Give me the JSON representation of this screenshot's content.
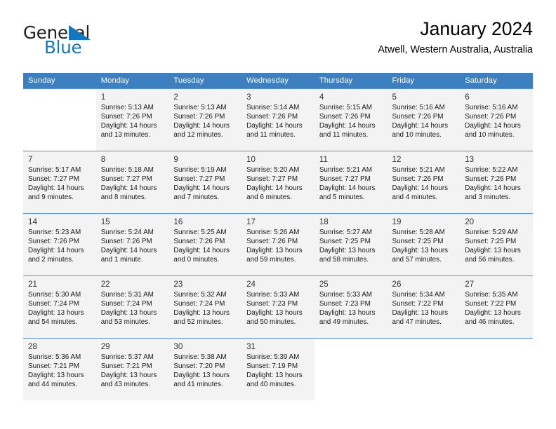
{
  "brand": {
    "name_part1": "General",
    "name_part2": "Blue",
    "triangle_color": "#1278be"
  },
  "header": {
    "title": "January 2024",
    "subtitle": "Atwell, Western Australia, Australia"
  },
  "theme": {
    "header_row_bg": "#3d7fbf",
    "header_row_text": "#ffffff",
    "row_shaded_bg": "#f3f3f3",
    "row_plain_bg": "#ffffff",
    "cell_border": "#5b92cd"
  },
  "calendar": {
    "weekdays": [
      "Sunday",
      "Monday",
      "Tuesday",
      "Wednesday",
      "Thursday",
      "Friday",
      "Saturday"
    ],
    "weeks": [
      [
        {
          "day": "",
          "sunrise": "",
          "sunset": "",
          "daylight1": "",
          "daylight2": ""
        },
        {
          "day": "1",
          "sunrise": "Sunrise: 5:13 AM",
          "sunset": "Sunset: 7:26 PM",
          "daylight1": "Daylight: 14 hours",
          "daylight2": "and 13 minutes."
        },
        {
          "day": "2",
          "sunrise": "Sunrise: 5:13 AM",
          "sunset": "Sunset: 7:26 PM",
          "daylight1": "Daylight: 14 hours",
          "daylight2": "and 12 minutes."
        },
        {
          "day": "3",
          "sunrise": "Sunrise: 5:14 AM",
          "sunset": "Sunset: 7:26 PM",
          "daylight1": "Daylight: 14 hours",
          "daylight2": "and 11 minutes."
        },
        {
          "day": "4",
          "sunrise": "Sunrise: 5:15 AM",
          "sunset": "Sunset: 7:26 PM",
          "daylight1": "Daylight: 14 hours",
          "daylight2": "and 11 minutes."
        },
        {
          "day": "5",
          "sunrise": "Sunrise: 5:16 AM",
          "sunset": "Sunset: 7:26 PM",
          "daylight1": "Daylight: 14 hours",
          "daylight2": "and 10 minutes."
        },
        {
          "day": "6",
          "sunrise": "Sunrise: 5:16 AM",
          "sunset": "Sunset: 7:26 PM",
          "daylight1": "Daylight: 14 hours",
          "daylight2": "and 10 minutes."
        }
      ],
      [
        {
          "day": "7",
          "sunrise": "Sunrise: 5:17 AM",
          "sunset": "Sunset: 7:27 PM",
          "daylight1": "Daylight: 14 hours",
          "daylight2": "and 9 minutes."
        },
        {
          "day": "8",
          "sunrise": "Sunrise: 5:18 AM",
          "sunset": "Sunset: 7:27 PM",
          "daylight1": "Daylight: 14 hours",
          "daylight2": "and 8 minutes."
        },
        {
          "day": "9",
          "sunrise": "Sunrise: 5:19 AM",
          "sunset": "Sunset: 7:27 PM",
          "daylight1": "Daylight: 14 hours",
          "daylight2": "and 7 minutes."
        },
        {
          "day": "10",
          "sunrise": "Sunrise: 5:20 AM",
          "sunset": "Sunset: 7:27 PM",
          "daylight1": "Daylight: 14 hours",
          "daylight2": "and 6 minutes."
        },
        {
          "day": "11",
          "sunrise": "Sunrise: 5:21 AM",
          "sunset": "Sunset: 7:27 PM",
          "daylight1": "Daylight: 14 hours",
          "daylight2": "and 5 minutes."
        },
        {
          "day": "12",
          "sunrise": "Sunrise: 5:21 AM",
          "sunset": "Sunset: 7:26 PM",
          "daylight1": "Daylight: 14 hours",
          "daylight2": "and 4 minutes."
        },
        {
          "day": "13",
          "sunrise": "Sunrise: 5:22 AM",
          "sunset": "Sunset: 7:26 PM",
          "daylight1": "Daylight: 14 hours",
          "daylight2": "and 3 minutes."
        }
      ],
      [
        {
          "day": "14",
          "sunrise": "Sunrise: 5:23 AM",
          "sunset": "Sunset: 7:26 PM",
          "daylight1": "Daylight: 14 hours",
          "daylight2": "and 2 minutes."
        },
        {
          "day": "15",
          "sunrise": "Sunrise: 5:24 AM",
          "sunset": "Sunset: 7:26 PM",
          "daylight1": "Daylight: 14 hours",
          "daylight2": "and 1 minute."
        },
        {
          "day": "16",
          "sunrise": "Sunrise: 5:25 AM",
          "sunset": "Sunset: 7:26 PM",
          "daylight1": "Daylight: 14 hours",
          "daylight2": "and 0 minutes."
        },
        {
          "day": "17",
          "sunrise": "Sunrise: 5:26 AM",
          "sunset": "Sunset: 7:26 PM",
          "daylight1": "Daylight: 13 hours",
          "daylight2": "and 59 minutes."
        },
        {
          "day": "18",
          "sunrise": "Sunrise: 5:27 AM",
          "sunset": "Sunset: 7:25 PM",
          "daylight1": "Daylight: 13 hours",
          "daylight2": "and 58 minutes."
        },
        {
          "day": "19",
          "sunrise": "Sunrise: 5:28 AM",
          "sunset": "Sunset: 7:25 PM",
          "daylight1": "Daylight: 13 hours",
          "daylight2": "and 57 minutes."
        },
        {
          "day": "20",
          "sunrise": "Sunrise: 5:29 AM",
          "sunset": "Sunset: 7:25 PM",
          "daylight1": "Daylight: 13 hours",
          "daylight2": "and 56 minutes."
        }
      ],
      [
        {
          "day": "21",
          "sunrise": "Sunrise: 5:30 AM",
          "sunset": "Sunset: 7:24 PM",
          "daylight1": "Daylight: 13 hours",
          "daylight2": "and 54 minutes."
        },
        {
          "day": "22",
          "sunrise": "Sunrise: 5:31 AM",
          "sunset": "Sunset: 7:24 PM",
          "daylight1": "Daylight: 13 hours",
          "daylight2": "and 53 minutes."
        },
        {
          "day": "23",
          "sunrise": "Sunrise: 5:32 AM",
          "sunset": "Sunset: 7:24 PM",
          "daylight1": "Daylight: 13 hours",
          "daylight2": "and 52 minutes."
        },
        {
          "day": "24",
          "sunrise": "Sunrise: 5:33 AM",
          "sunset": "Sunset: 7:23 PM",
          "daylight1": "Daylight: 13 hours",
          "daylight2": "and 50 minutes."
        },
        {
          "day": "25",
          "sunrise": "Sunrise: 5:33 AM",
          "sunset": "Sunset: 7:23 PM",
          "daylight1": "Daylight: 13 hours",
          "daylight2": "and 49 minutes."
        },
        {
          "day": "26",
          "sunrise": "Sunrise: 5:34 AM",
          "sunset": "Sunset: 7:22 PM",
          "daylight1": "Daylight: 13 hours",
          "daylight2": "and 47 minutes."
        },
        {
          "day": "27",
          "sunrise": "Sunrise: 5:35 AM",
          "sunset": "Sunset: 7:22 PM",
          "daylight1": "Daylight: 13 hours",
          "daylight2": "and 46 minutes."
        }
      ],
      [
        {
          "day": "28",
          "sunrise": "Sunrise: 5:36 AM",
          "sunset": "Sunset: 7:21 PM",
          "daylight1": "Daylight: 13 hours",
          "daylight2": "and 44 minutes."
        },
        {
          "day": "29",
          "sunrise": "Sunrise: 5:37 AM",
          "sunset": "Sunset: 7:21 PM",
          "daylight1": "Daylight: 13 hours",
          "daylight2": "and 43 minutes."
        },
        {
          "day": "30",
          "sunrise": "Sunrise: 5:38 AM",
          "sunset": "Sunset: 7:20 PM",
          "daylight1": "Daylight: 13 hours",
          "daylight2": "and 41 minutes."
        },
        {
          "day": "31",
          "sunrise": "Sunrise: 5:39 AM",
          "sunset": "Sunset: 7:19 PM",
          "daylight1": "Daylight: 13 hours",
          "daylight2": "and 40 minutes."
        },
        {
          "day": "",
          "sunrise": "",
          "sunset": "",
          "daylight1": "",
          "daylight2": ""
        },
        {
          "day": "",
          "sunrise": "",
          "sunset": "",
          "daylight1": "",
          "daylight2": ""
        },
        {
          "day": "",
          "sunrise": "",
          "sunset": "",
          "daylight1": "",
          "daylight2": ""
        }
      ]
    ]
  }
}
